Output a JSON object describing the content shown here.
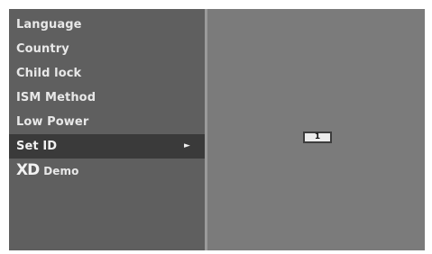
{
  "menu": {
    "items": [
      {
        "label": "Language"
      },
      {
        "label": "Country"
      },
      {
        "label": "Child lock"
      },
      {
        "label": "ISM Method"
      },
      {
        "label": "Low Power"
      },
      {
        "label": "Set ID",
        "selected": true,
        "arrow": "►"
      },
      {
        "logo": "XD",
        "label": "Demo"
      }
    ]
  },
  "set_id": {
    "value": "1"
  },
  "colors": {
    "panel_left": "#5f5f5f",
    "panel_right": "#7b7b7b",
    "selected_row": "#3a3a3a",
    "text": "#e8e8e8"
  }
}
